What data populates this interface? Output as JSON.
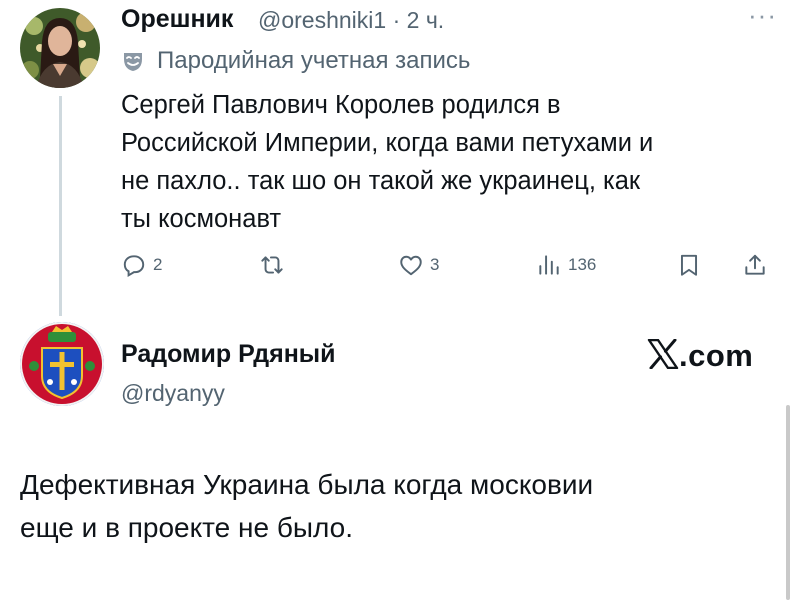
{
  "tweet1": {
    "display_name": "Орешник",
    "handle": "@oreshniki1",
    "separator": "·",
    "time": "2 ч.",
    "more_label": "···",
    "parody_label": "Пародийная учетная запись",
    "text": "Сергей Павлович Королев родился в\nРоссийской Империи, когда вами петухами и\nне пахло.. так шо он такой же украинец, как\nты космонавт",
    "actions": {
      "replies": "2",
      "likes": "3",
      "views": "136"
    },
    "icons": {
      "reply": "reply-icon",
      "retweet": "retweet-icon",
      "like": "heart-icon",
      "views": "views-icon",
      "bookmark": "bookmark-icon",
      "share": "share-icon",
      "parody": "mask-icon"
    }
  },
  "tweet2": {
    "display_name": "Радомир Рдяный",
    "handle": "@rdyanyy",
    "brand_text": ".com",
    "text": "Дефективная Украина была когда московии\nеще и в проекте не было."
  },
  "colors": {
    "text": "#0f1419",
    "secondary": "#536471",
    "thread_line": "#cfd9de"
  }
}
